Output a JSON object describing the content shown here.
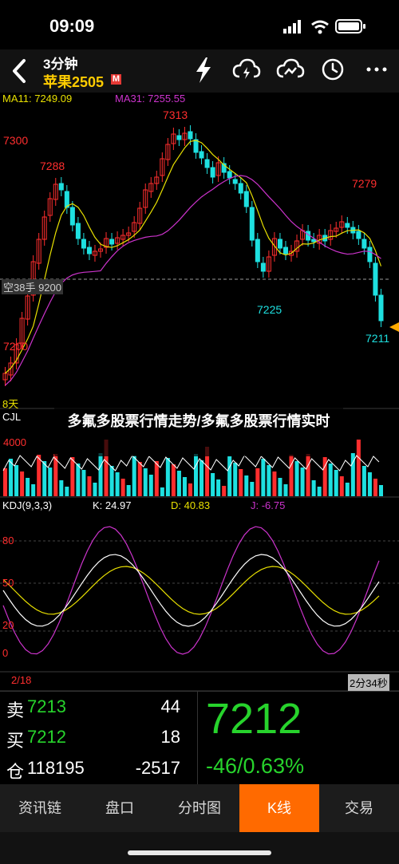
{
  "status": {
    "time": "09:09"
  },
  "nav": {
    "title": "3分钟",
    "subtitle": "苹果2505",
    "badge": "M"
  },
  "chart_header": {
    "ma11": "MA11: 7249.09",
    "ma31": "MA31: 7255.55"
  },
  "price_axis": {
    "p7300": "7300",
    "p7200": "7200"
  },
  "annotations": {
    "high": "7313",
    "left_high": "7288",
    "right_high": "7279",
    "low": "7225",
    "last": "7211",
    "position_line": "空38手 9200",
    "days": "8天"
  },
  "volume_panel": {
    "title": "CJL",
    "tick": "4000"
  },
  "kdj_panel": {
    "title": "KDJ(9,3,3)",
    "k": "K: 24.97",
    "d": "D: 40.83",
    "j": "J: -6.75",
    "ticks": [
      "80",
      "50",
      "20",
      "0"
    ]
  },
  "time_axis": {
    "date": "2/18",
    "countdown": "2分34秒"
  },
  "overlay": {
    "text": "多氟多股票行情走势/多氟多股票行情实时"
  },
  "quote": {
    "sell_label": "卖",
    "sell_price": "7213",
    "sell_qty": "44",
    "buy_label": "买",
    "buy_price": "7212",
    "buy_qty": "18",
    "oi_label": "仓",
    "oi_value": "118195",
    "oi_change": "-2517",
    "last_price": "7212",
    "change": "-46/0.63%"
  },
  "tabs": [
    "资讯链",
    "盘口",
    "分时图",
    "K线",
    "交易"
  ],
  "active_tab": "K线",
  "colors": {
    "up": "#ff2e2e",
    "down": "#1ee0e0",
    "ma11": "#e8e000",
    "ma31": "#cc33cc",
    "accent": "#ff6a00",
    "quote_green": "#27d32c"
  }
}
